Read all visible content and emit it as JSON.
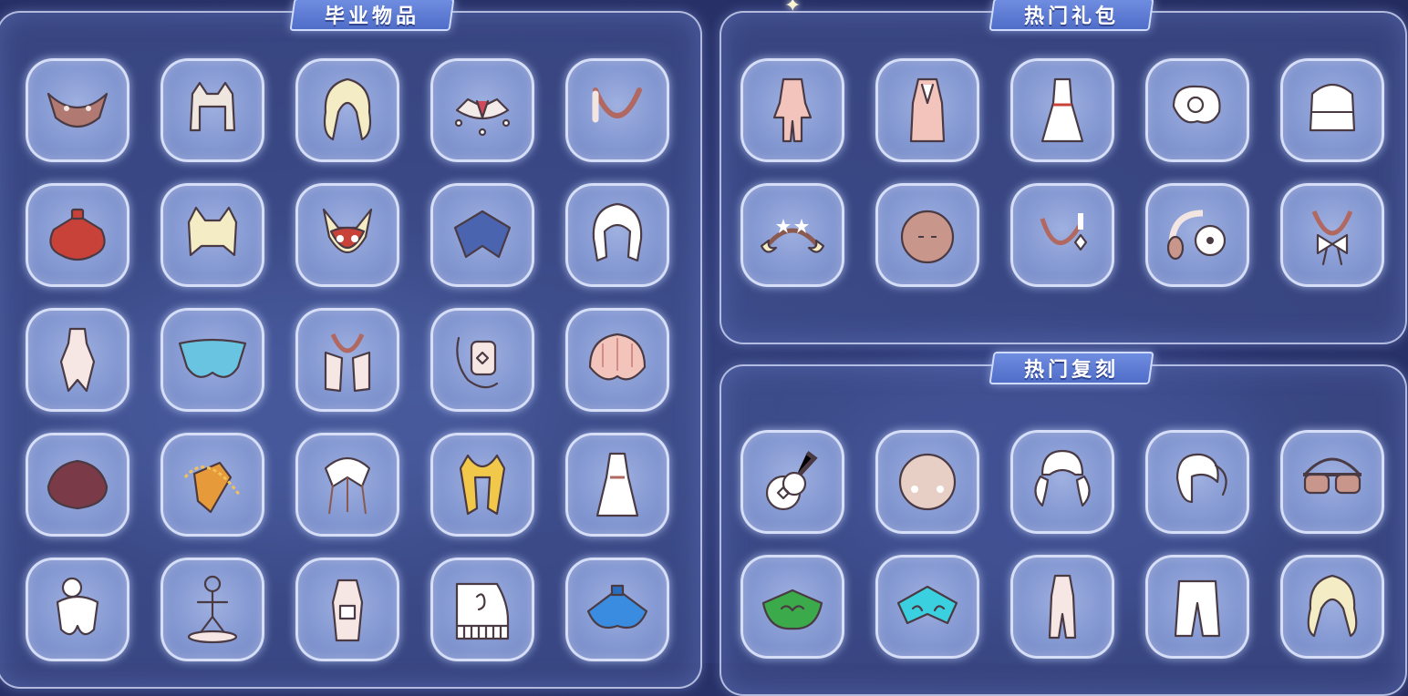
{
  "panels": {
    "graduation": {
      "title": "毕业物品",
      "items": [
        {
          "icon": "wing-shoulder-icon"
        },
        {
          "icon": "cat-ear-hair-icon"
        },
        {
          "icon": "long-blonde-hair-icon"
        },
        {
          "icon": "star-collar-icon"
        },
        {
          "icon": "necklace-icon"
        },
        {
          "icon": "red-cape-icon"
        },
        {
          "icon": "fox-ear-hair-icon"
        },
        {
          "icon": "owl-mask-icon"
        },
        {
          "icon": "blue-cape-icon"
        },
        {
          "icon": "white-hood-icon"
        },
        {
          "icon": "white-outfit-icon"
        },
        {
          "icon": "cyan-cape-icon"
        },
        {
          "icon": "scarf-outfit-icon"
        },
        {
          "icon": "tablet-prop-icon"
        },
        {
          "icon": "shell-hair-icon"
        },
        {
          "icon": "maroon-cape-icon"
        },
        {
          "icon": "gold-ribbon-cape-icon"
        },
        {
          "icon": "feather-hair-icon"
        },
        {
          "icon": "gold-scarf-icon"
        },
        {
          "icon": "dress-icon"
        },
        {
          "icon": "bun-hair-icon"
        },
        {
          "icon": "figure-statue-icon"
        },
        {
          "icon": "armor-outfit-icon"
        },
        {
          "icon": "piano-icon"
        },
        {
          "icon": "blue-cape-2-icon"
        }
      ]
    },
    "hot_packs": {
      "title": "热门礼包",
      "items": [
        {
          "icon": "pink-outfit-icon"
        },
        {
          "icon": "robe-outfit-icon"
        },
        {
          "icon": "white-dress-icon"
        },
        {
          "icon": "bun-hair-2-icon"
        },
        {
          "icon": "cream-hair-icon"
        },
        {
          "icon": "moon-headband-icon"
        },
        {
          "icon": "mask-icon"
        },
        {
          "icon": "pendant-icon"
        },
        {
          "icon": "headphones-icon"
        },
        {
          "icon": "bow-necklace-icon"
        }
      ]
    },
    "hot_reruns": {
      "title": "热门复刻",
      "items": [
        {
          "icon": "guitar-icon"
        },
        {
          "icon": "blush-mask-icon"
        },
        {
          "icon": "twin-tail-hair-icon"
        },
        {
          "icon": "ponytail-hair-icon"
        },
        {
          "icon": "sunglasses-icon"
        },
        {
          "icon": "green-cape-icon"
        },
        {
          "icon": "teal-cape-icon"
        },
        {
          "icon": "tall-outfit-icon"
        },
        {
          "icon": "pants-icon"
        },
        {
          "icon": "curly-hair-icon"
        }
      ]
    }
  },
  "colors": {
    "background": "#2c3670",
    "panel_border": "#dce4ff",
    "title_bar": "#5a78d2",
    "tile_fill": "#8498d2"
  }
}
